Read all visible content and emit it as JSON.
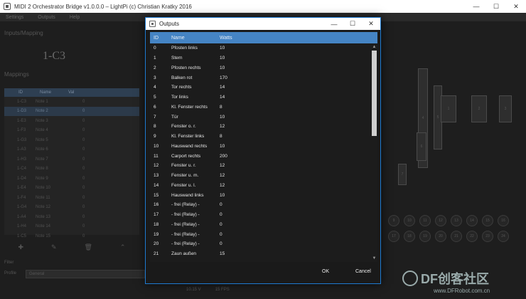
{
  "main_window": {
    "title": "MIDI 2 Orchestrator Bridge v1.0.0.0 – LightPi (c) Christian Kratky 2016",
    "menu": [
      "Settings",
      "Outputs",
      "Help"
    ],
    "section_top": "Inputs/Mapping",
    "preset_name": "1-C3",
    "section_mid": "Mappings",
    "list_header": [
      "ID",
      "Name",
      "Val"
    ],
    "list_rows": [
      {
        "id": "1-C3",
        "name": "Note 1",
        "val": "0"
      },
      {
        "id": "1-D3",
        "name": "Note 2",
        "val": "0"
      },
      {
        "id": "1-E3",
        "name": "Note 3",
        "val": "0"
      },
      {
        "id": "1-F3",
        "name": "Note 4",
        "val": "0"
      },
      {
        "id": "1-G3",
        "name": "Note 5",
        "val": "0"
      },
      {
        "id": "1-A3",
        "name": "Note 6",
        "val": "0"
      },
      {
        "id": "1-H3",
        "name": "Note 7",
        "val": "0"
      },
      {
        "id": "1-C4",
        "name": "Note 8",
        "val": "0"
      },
      {
        "id": "1-D4",
        "name": "Note 9",
        "val": "0"
      },
      {
        "id": "1-E4",
        "name": "Note 10",
        "val": "0"
      },
      {
        "id": "1-F4",
        "name": "Note 11",
        "val": "0"
      },
      {
        "id": "1-G4",
        "name": "Note 12",
        "val": "0"
      },
      {
        "id": "1-A4",
        "name": "Note 13",
        "val": "0"
      },
      {
        "id": "1-H4",
        "name": "Note 14",
        "val": "0"
      },
      {
        "id": "1-C5",
        "name": "Note 15",
        "val": "0"
      }
    ],
    "filter_label": "Filter",
    "profile_label": "Profile",
    "profile_value": "General",
    "status_left": "10.15 V",
    "status_right": "15 FPS",
    "win_buttons": {
      "minimize": "—",
      "maximize": "☐",
      "close": "✕"
    },
    "toolbar_icons": {
      "add": "✚",
      "edit": "✎",
      "delete": "🗑",
      "up": "⌃"
    },
    "plan_labels": [
      "4",
      "5",
      "6",
      "7",
      "1",
      "2",
      "3"
    ],
    "plan_circles": [
      "9",
      "10",
      "11",
      "12",
      "13",
      "14",
      "15",
      "16",
      "17",
      "18",
      "19",
      "20",
      "21",
      "22",
      "23",
      "24"
    ]
  },
  "dialog": {
    "title": "Outputs",
    "columns": {
      "id": "ID",
      "name": "Name",
      "watts": "Watts"
    },
    "rows": [
      {
        "id": "0",
        "name": "Pfosten links",
        "watts": "10"
      },
      {
        "id": "1",
        "name": "Stern",
        "watts": "10"
      },
      {
        "id": "2",
        "name": "Pfosten rechts",
        "watts": "10"
      },
      {
        "id": "3",
        "name": "Balken rot",
        "watts": "170"
      },
      {
        "id": "4",
        "name": "Tor rechts",
        "watts": "14"
      },
      {
        "id": "5",
        "name": "Tor links",
        "watts": "14"
      },
      {
        "id": "6",
        "name": "Kl. Fenster rechts",
        "watts": "8"
      },
      {
        "id": "7",
        "name": "Tür",
        "watts": "10"
      },
      {
        "id": "8",
        "name": "Fenster o. r.",
        "watts": "12"
      },
      {
        "id": "9",
        "name": "Kl. Fenster links",
        "watts": "8"
      },
      {
        "id": "10",
        "name": "Hauswand rechts",
        "watts": "10"
      },
      {
        "id": "11",
        "name": "Carport rechts",
        "watts": "200"
      },
      {
        "id": "12",
        "name": "Fenster u. r.",
        "watts": "12"
      },
      {
        "id": "13",
        "name": "Fenster u. m.",
        "watts": "12"
      },
      {
        "id": "14",
        "name": "Fenster u. l.",
        "watts": "12"
      },
      {
        "id": "15",
        "name": "Hauswand links",
        "watts": "10"
      },
      {
        "id": "16",
        "name": "- frei (Relay) -",
        "watts": "0"
      },
      {
        "id": "17",
        "name": "- frei (Relay) -",
        "watts": "0"
      },
      {
        "id": "18",
        "name": "- frei (Relay) -",
        "watts": "0"
      },
      {
        "id": "19",
        "name": "- frei (Relay) -",
        "watts": "0"
      },
      {
        "id": "20",
        "name": "- frei (Relay) -",
        "watts": "0"
      },
      {
        "id": "21",
        "name": "Zaun außen",
        "watts": "15"
      }
    ],
    "ok_label": "OK",
    "cancel_label": "Cancel",
    "win_buttons": {
      "minimize": "—",
      "maximize": "☐",
      "close": "✕"
    },
    "scroll_up": "▲",
    "scroll_down": "▼"
  },
  "watermark": {
    "brand": "DF创客社区",
    "url": "www.DFRobot.com.cn"
  }
}
